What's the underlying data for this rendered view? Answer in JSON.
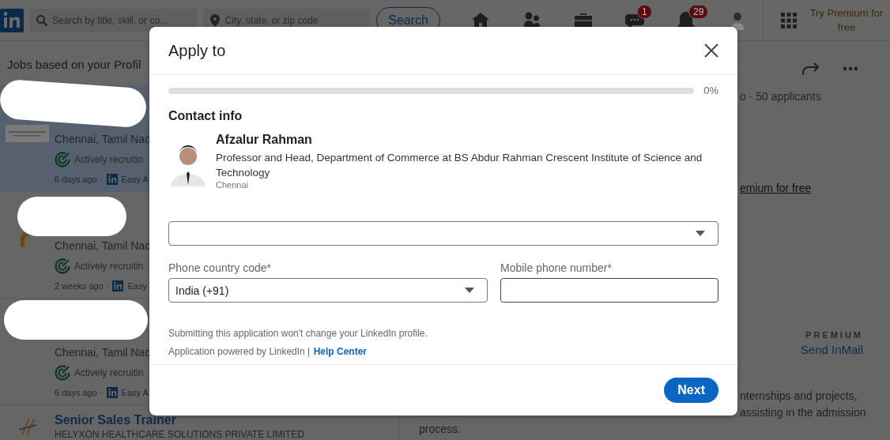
{
  "header": {
    "search_placeholder": "Search by title, skill, or co...",
    "location_placeholder": "City, state, or zip code",
    "search_button": "Search",
    "nav": [
      {
        "kind": "home"
      },
      {
        "kind": "people"
      },
      {
        "kind": "briefcase"
      },
      {
        "kind": "chat",
        "badge": "1"
      },
      {
        "kind": "bell",
        "badge": "29"
      },
      {
        "kind": "avatar"
      }
    ],
    "premium": "Try Premium for free"
  },
  "job_list": {
    "heading": "Jobs based on your Profil",
    "jobs": [
      {
        "selected": true,
        "location": "Chennai, Tamil Nad",
        "status": "Actively recruitin",
        "posted": "6 days ago ·",
        "apply": "Easy A"
      },
      {
        "selected": false,
        "location": "Chennai, Tamil Nad",
        "status": "Actively recruitin",
        "posted": "2 weeks ago ·",
        "apply": "Easy"
      },
      {
        "selected": false,
        "location": "Chennai, Tamil Nad",
        "status": "Actively recruitin",
        "posted": "6 days ago ·",
        "apply": "Easy A"
      }
    ],
    "last_job": {
      "title": "Senior Sales Trainer",
      "company": "HELYXON HEALTHCARE SOLUTIONS PRIVATE LIMITED"
    }
  },
  "job_detail": {
    "applicants": "o · 50 applicants",
    "premium_link": "emium for free",
    "premium_label": "PREMIUM",
    "inmail": "Send InMail",
    "description": [
      "nternships and projects,",
      "assisting in the admission",
      "process."
    ]
  },
  "modal": {
    "title": "Apply to",
    "progress": {
      "level": 0,
      "reading": "0%"
    },
    "section": "Contact info",
    "profile": {
      "name": "Afzalur Rahman",
      "headline": "Professor and Head, Department of Commerce at BS Abdur Rahman Crescent Institute of Science and Technology",
      "location": "Chennai"
    },
    "country_code": {
      "label": "Phone country code*",
      "value": "India (+91)"
    },
    "mobile": {
      "label": "Mobile phone number*"
    },
    "notes": [
      "Submitting this application won't change your LinkedIn profile.",
      "Application powered by LinkedIn |"
    ],
    "help_link": "Help Center",
    "next_button": "Next"
  }
}
